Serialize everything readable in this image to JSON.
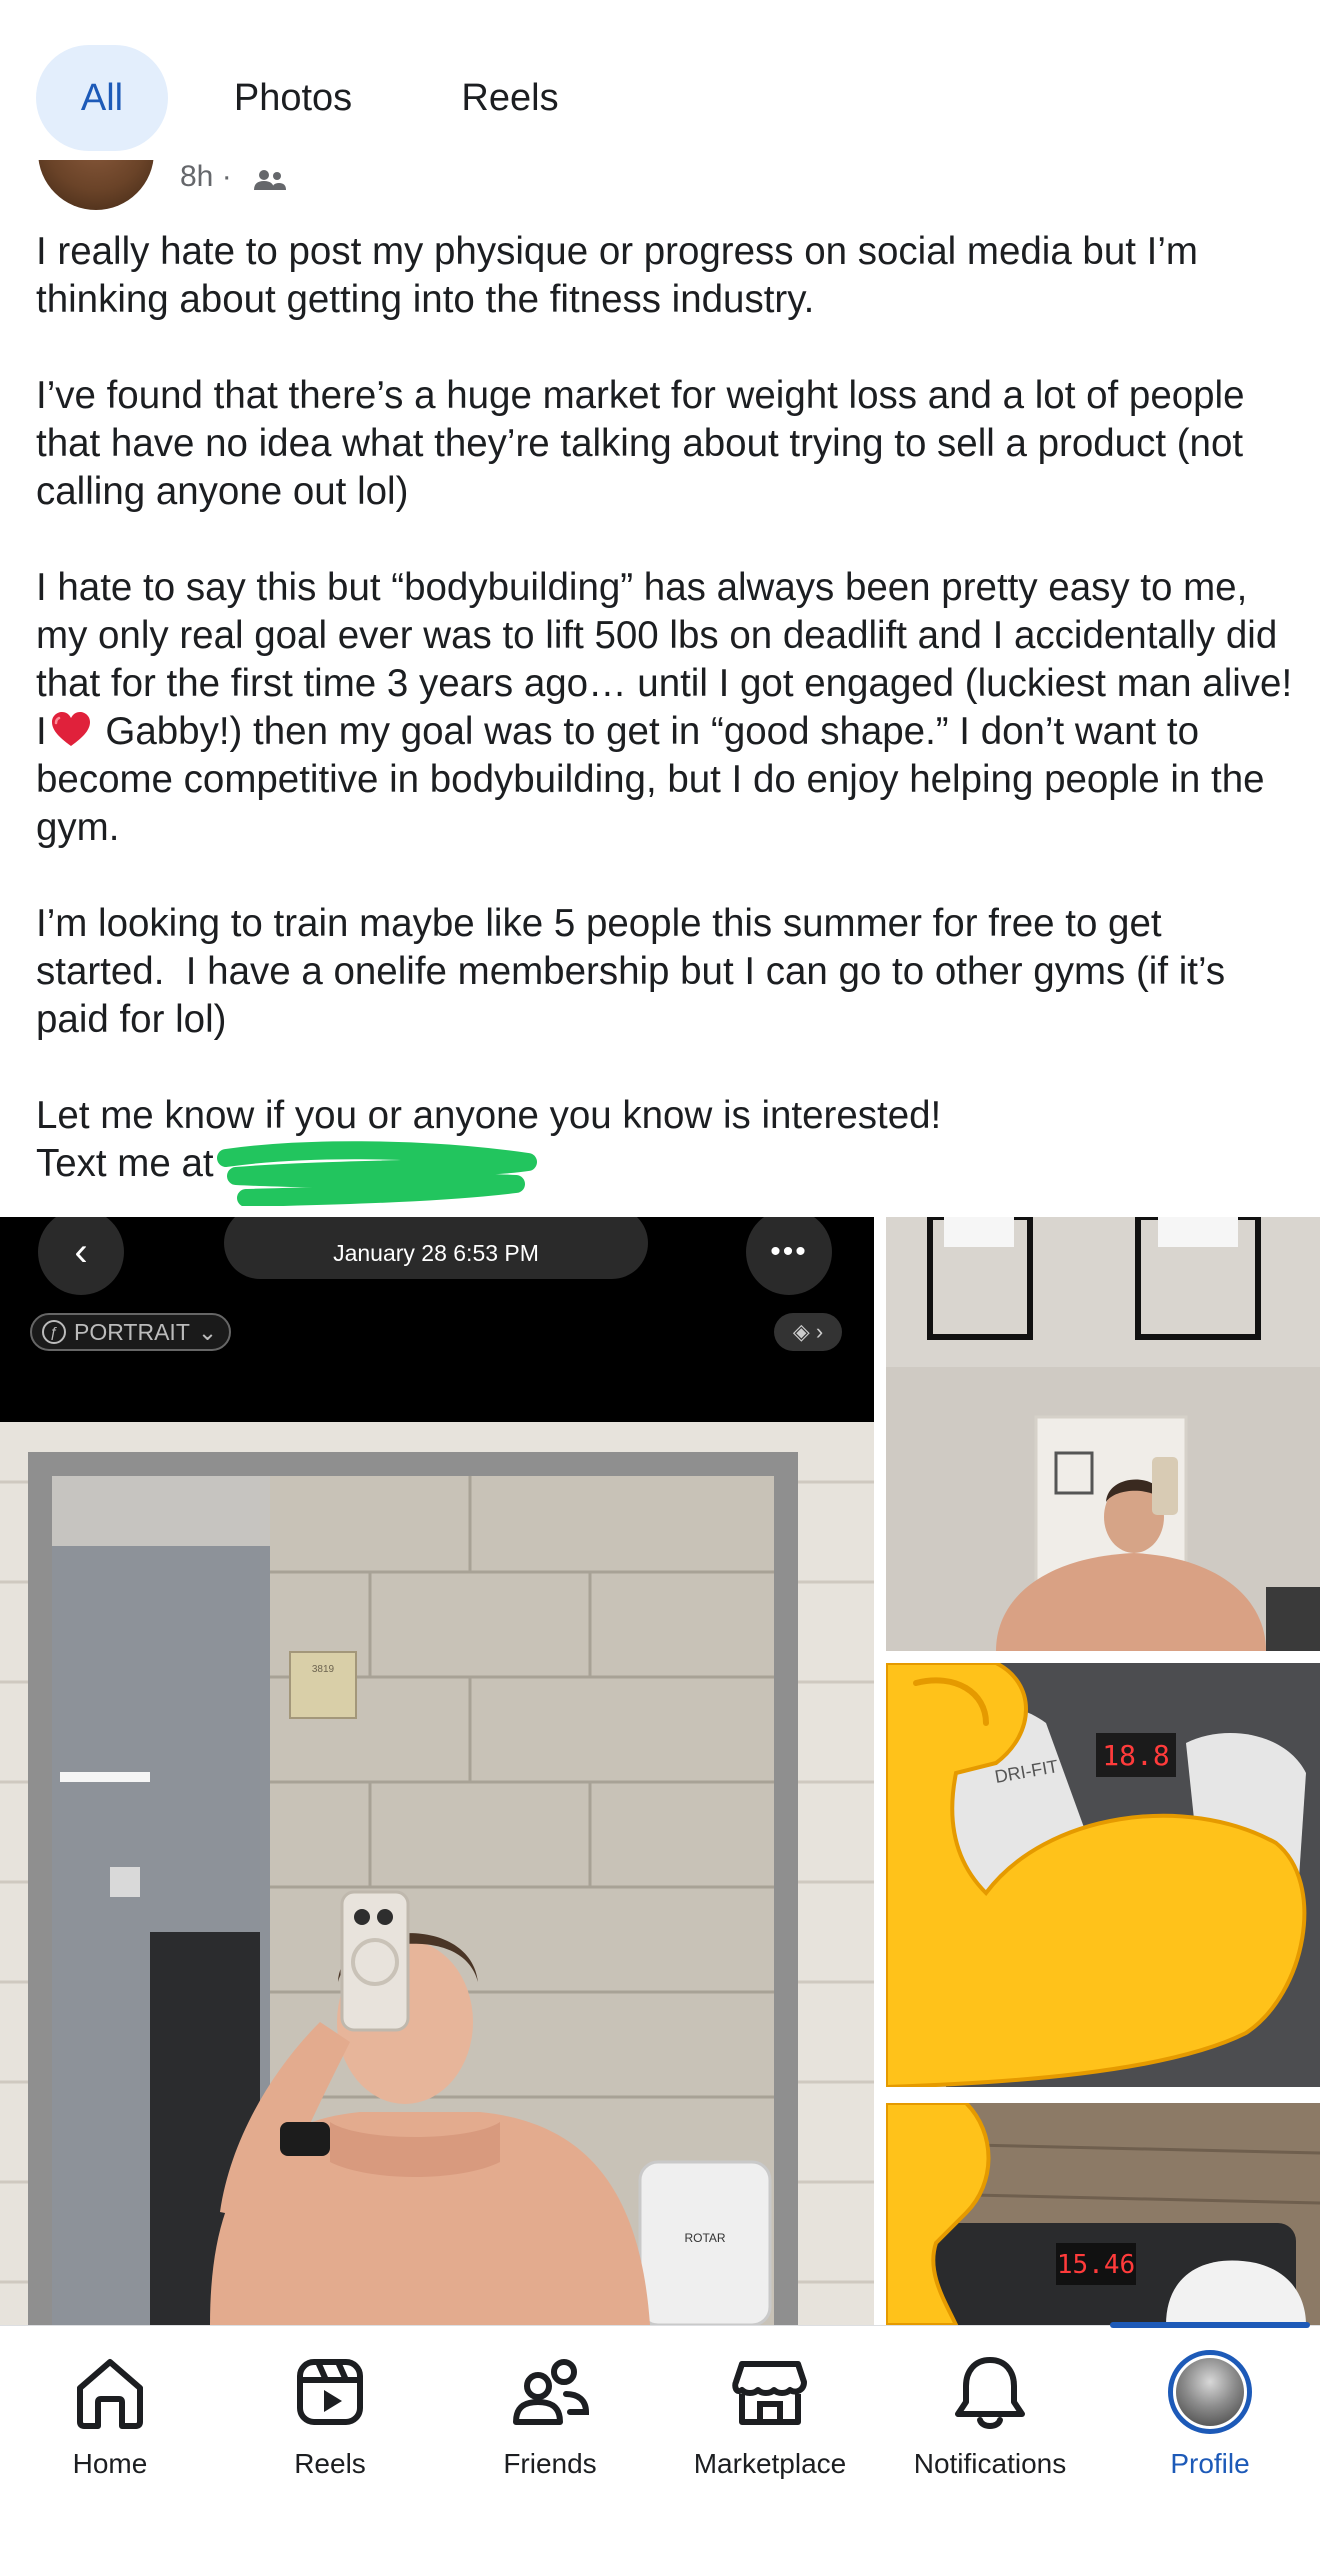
{
  "tabs": [
    {
      "label": "All",
      "active": true
    },
    {
      "label": "Photos",
      "active": false
    },
    {
      "label": "Reels",
      "active": false
    }
  ],
  "post": {
    "time": "8h ·",
    "paragraphs": [
      "I really hate to post my physique or progress on social media but I’m thinking about getting into the fitness industry.",
      "I’ve found that there’s a huge market for weight loss and a lot of people that have no idea what they’re talking about trying to sell a product (not calling anyone out lol)",
      "I’m looking to train maybe like 5 people this summer for free to get started.  I have a onelife membership but I can go to other gyms (if it’s paid for lol)"
    ],
    "p3_before_heart": "I hate to say this but “bodybuilding” has always been pretty easy to me, my only real goal ever was to lift 500 lbs on deadlift and I accidentally did that for the first time 3 years ago… until I got engaged (luckiest man alive! I",
    "p3_after_heart": " Gabby!) then my goal was to get in “good shape.” I don’t want to become competitive in bodybuilding, but I do enjoy helping people in the gym.",
    "closing_line1": "Let me know if you or anyone you know is interested!",
    "closing_line2": "Text me at",
    "redaction_color": "#22c55e"
  },
  "media": {
    "main_photo": {
      "date_label": "January 28  6:53 PM",
      "portrait_label": "PORTRAIT",
      "sign_text": "3819",
      "dryer_text": "ROTAR"
    },
    "side_photos": [
      {
        "name": "bathroom-mirror-selfie"
      },
      {
        "name": "scale-feet-photo",
        "scale_reading": "18.8",
        "sock_text": "DRI-FIT"
      },
      {
        "name": "scale-photo-2",
        "scale_reading": "15.46"
      }
    ]
  },
  "bottom_nav": [
    {
      "label": "Home",
      "icon": "home-icon",
      "active": false
    },
    {
      "label": "Reels",
      "icon": "reels-icon",
      "active": false
    },
    {
      "label": "Friends",
      "icon": "friends-icon",
      "active": false
    },
    {
      "label": "Marketplace",
      "icon": "marketplace-icon",
      "active": false
    },
    {
      "label": "Notifications",
      "icon": "bell-icon",
      "active": false
    },
    {
      "label": "Profile",
      "icon": "profile-avatar",
      "active": true
    }
  ],
  "colors": {
    "accent": "#1d5ab8",
    "active_tab_bg": "#e3eefc",
    "text": "#1c1e21"
  }
}
